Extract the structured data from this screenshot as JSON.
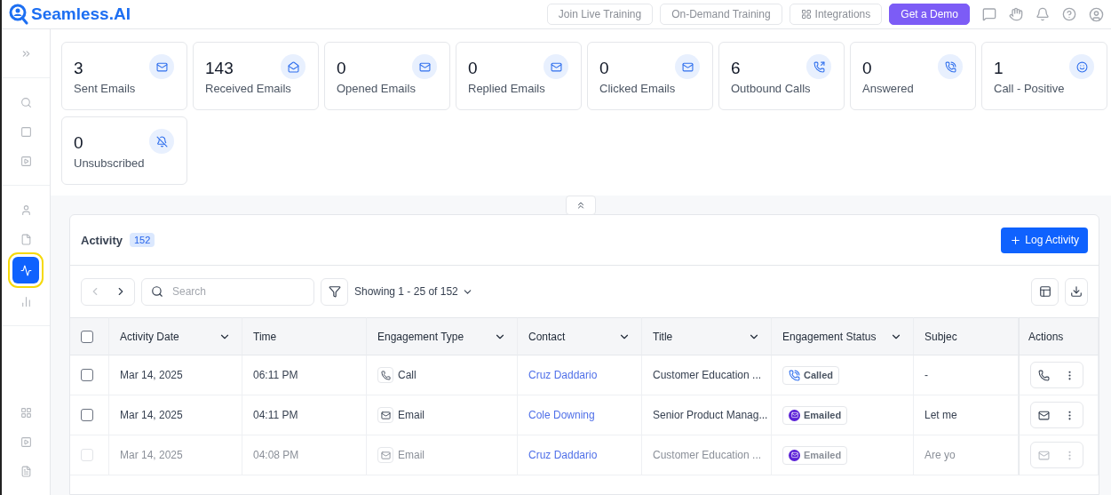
{
  "header": {
    "logo": "Seamless.AI",
    "buttons": [
      {
        "label": "Join Live Training",
        "kind": "plain"
      },
      {
        "label": "On-Demand Training",
        "kind": "plain"
      },
      {
        "label": "Integrations",
        "kind": "icon"
      },
      {
        "label": "Get a Demo",
        "kind": "primary"
      }
    ]
  },
  "sidebar": {
    "groups": [
      {
        "items": [
          {
            "selected": false
          }
        ]
      },
      {
        "items": [
          {
            "selected": false
          },
          {
            "selected": false
          },
          {
            "selected": false
          }
        ]
      },
      {
        "items": [
          {
            "selected": false
          },
          {
            "selected": false
          },
          {
            "selected": true
          },
          {
            "selected": false
          }
        ]
      },
      {
        "items": [
          {
            "selected": false
          },
          {
            "selected": false
          },
          {
            "selected": false
          }
        ]
      }
    ]
  },
  "stats": [
    {
      "value": "3",
      "label": "Sent Emails"
    },
    {
      "value": "143",
      "label": "Received Emails"
    },
    {
      "value": "0",
      "label": "Opened Emails"
    },
    {
      "value": "0",
      "label": "Replied Emails"
    },
    {
      "value": "0",
      "label": "Clicked Emails"
    },
    {
      "value": "6",
      "label": "Outbound Calls"
    },
    {
      "value": "0",
      "label": "Answered"
    },
    {
      "value": "1",
      "label": "Call - Positive"
    },
    {
      "value": "0",
      "label": "Unsubscribed"
    }
  ],
  "activity": {
    "title": "Activity",
    "count": "152",
    "log_button": "Log Activity",
    "search": {
      "placeholder": "Search"
    },
    "showing": "Showing 1 - 25 of 152",
    "table": {
      "header_checkbox": {
        "checked": false
      },
      "columns": [
        {
          "label": "Activity Date",
          "sortable": true
        },
        {
          "label": "Time",
          "sortable": false
        },
        {
          "label": "Engagement Type",
          "sortable": true
        },
        {
          "label": "Contact",
          "sortable": true
        },
        {
          "label": "Title",
          "sortable": true
        },
        {
          "label": "Engagement Status",
          "sortable": true
        },
        {
          "label": "Subjec",
          "sortable": false
        },
        {
          "label": "Actions",
          "sortable": false
        }
      ],
      "rows": [
        {
          "checked": false,
          "faded": false,
          "date": "Mar 14, 2025",
          "time": "06:11 PM",
          "type": {
            "kind": "call",
            "label": "Call"
          },
          "contact": "Cruz Daddario",
          "title": "Customer Education ...",
          "status": {
            "kind": "called",
            "label": "Called"
          },
          "subject": "-"
        },
        {
          "checked": false,
          "faded": false,
          "date": "Mar 14, 2025",
          "time": "04:11 PM",
          "type": {
            "kind": "email",
            "label": "Email"
          },
          "contact": "Cole Downing",
          "title": "Senior Product Manag...",
          "status": {
            "kind": "emailed",
            "label": "Emailed"
          },
          "subject": "Let me"
        },
        {
          "checked": false,
          "faded": true,
          "date": "Mar 14, 2025",
          "time": "04:08 PM",
          "type": {
            "kind": "email",
            "label": "Email"
          },
          "contact": "Cruz Daddario",
          "title": "Customer Education ...",
          "status": {
            "kind": "emailed",
            "label": "Emailed"
          },
          "subject": "Are yo"
        }
      ]
    }
  }
}
